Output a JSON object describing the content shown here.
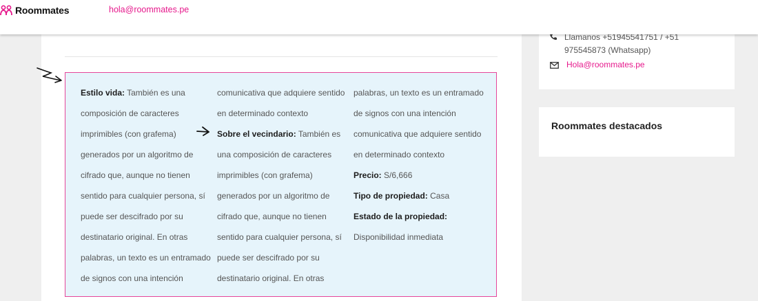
{
  "header": {
    "brand": "Roommates",
    "email": "hola@roommates.pe"
  },
  "listing": {
    "columns": [
      [
        {
          "label": "Estilo vida:",
          "text": " También es una"
        },
        {
          "text": "composición de caracteres"
        },
        {
          "text": "imprimibles (con grafema)"
        },
        {
          "text": "generados por un algoritmo de"
        },
        {
          "text": "cifrado que, aunque no tienen"
        },
        {
          "text": "sentido para cualquier persona, sí"
        },
        {
          "text": "puede ser descifrado por su"
        },
        {
          "text": "destinatario original. En otras"
        },
        {
          "text": "palabras, un texto es un entramado"
        },
        {
          "text": "de signos con una intención"
        }
      ],
      [
        {
          "text": "comunicativa que adquiere sentido"
        },
        {
          "text": "en determinado contexto"
        },
        {
          "label": "Sobre el vecindario:",
          "text": " También es"
        },
        {
          "text": "una composición de caracteres"
        },
        {
          "text": "imprimibles (con grafema)"
        },
        {
          "text": "generados por un algoritmo de"
        },
        {
          "text": "cifrado que, aunque no tienen"
        },
        {
          "text": "sentido para cualquier persona, sí"
        },
        {
          "text": "puede ser descifrado por su"
        },
        {
          "text": "destinatario original. En otras"
        }
      ],
      [
        {
          "text": "palabras, un texto es un entramado"
        },
        {
          "text": "de signos con una intención"
        },
        {
          "text": "comunicativa que adquiere sentido"
        },
        {
          "text": "en determinado contexto"
        },
        {
          "label": "Precio:",
          "text": " S/6,666"
        },
        {
          "label": "Tipo de propiedad:",
          "text": " Casa"
        },
        {
          "label": "Estado de la propiedad:",
          "text": ""
        },
        {
          "text": "Disponibilidad inmediata"
        }
      ]
    ]
  },
  "sidebar": {
    "contact_phone_partial": "Llamanos +51945541751 / +51",
    "contact_whatsapp": "975545873 (Whatsapp)",
    "contact_email": "Hola@roommates.pe",
    "featured_title": "Roommates destacados"
  },
  "colors": {
    "accent": "#e6198c",
    "box_background": "#e6f4fb",
    "box_border": "#e64599"
  },
  "icons": [
    "roommates-logo-icon",
    "phone-icon",
    "mail-icon",
    "hand-drawn-arrow-icon"
  ]
}
